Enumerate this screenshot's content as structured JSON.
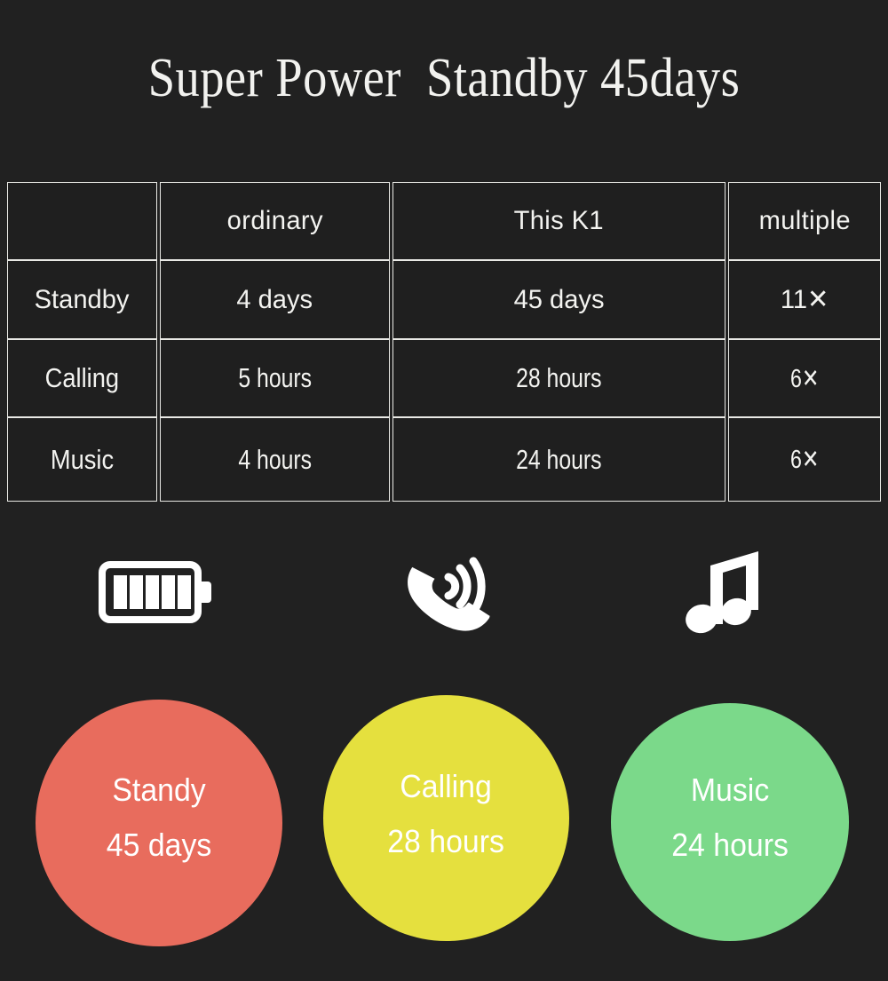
{
  "title": "Super Power  Standby 45days",
  "background_color": "#212121",
  "table": {
    "headers": [
      "",
      "ordinary",
      "This K1",
      "multiple"
    ],
    "rows": [
      {
        "label": "Standby",
        "ordinary": "4 days",
        "this_k1": "45 days",
        "multiple": "11✕"
      },
      {
        "label": "Calling",
        "ordinary": "5 hours",
        "this_k1": "28 hours",
        "multiple": "6✕"
      },
      {
        "label": "Music",
        "ordinary": "4 hours",
        "this_k1": "24 hours",
        "multiple": "6✕"
      }
    ]
  },
  "icons": [
    {
      "name": "battery-icon",
      "label": "battery"
    },
    {
      "name": "phone-call-icon",
      "label": "calling"
    },
    {
      "name": "music-note-icon",
      "label": "music"
    }
  ],
  "bubbles": [
    {
      "name": "standby",
      "line1": "Standy",
      "line2": "45 days",
      "color": "#E86C5D"
    },
    {
      "name": "calling",
      "line1": "Calling",
      "line2": "28 hours",
      "color": "#E5E03E"
    },
    {
      "name": "music",
      "line1": "Music",
      "line2": "24 hours",
      "color": "#7BD98A"
    }
  ]
}
